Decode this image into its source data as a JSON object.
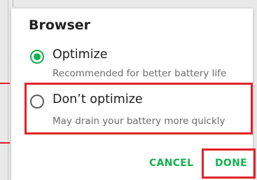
{
  "dialog": {
    "title": "Browser",
    "options": [
      {
        "label": "Optimize",
        "description": "Recommended for better battery life",
        "selected": true
      },
      {
        "label": "Don’t optimize",
        "description": "May drain your battery more quickly",
        "selected": false
      }
    ],
    "buttons": {
      "cancel": "CANCEL",
      "done": "DONE"
    }
  },
  "colors": {
    "accent": "#14b14f",
    "highlight": "#e0232a",
    "radio_unchecked": "#5f5f5f"
  }
}
